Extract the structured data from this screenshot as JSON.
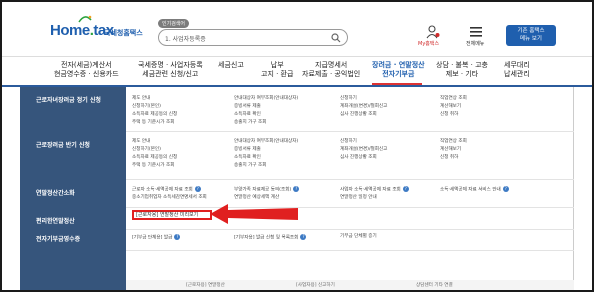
{
  "header": {
    "logo_text_a": "Home",
    "logo_text_b": "tax",
    "logo_sub": "국세청홈택스",
    "search_tag": "인기검색어",
    "search_value": "1. 사업자등록증",
    "my_label": "My홈택스",
    "menu_label": "전체메뉴",
    "basic_line1": "기존 홈택스",
    "basic_line2": "메뉴 보기"
  },
  "nav": [
    {
      "line1": "전자(세금)계산서",
      "line2": "현금영수증 · 신용카드"
    },
    {
      "line1": "국세증명 · 사업자등록",
      "line2": "세금관련 신청/신고"
    },
    {
      "line1": "세금신고",
      "line2": ""
    },
    {
      "line1": "납부",
      "line2": "고지 · 환급"
    },
    {
      "line1": "지급명세서",
      "line2": "자료제출 · 공익법인"
    },
    {
      "line1": "장려금 · 연말정산",
      "line2": "전자기부금"
    },
    {
      "line1": "상담 · 불복 · 고충",
      "line2": "제보 · 기타"
    },
    {
      "line1": "세무대리",
      "line2": "납세관리"
    }
  ],
  "categories": [
    "근로자녀장려금 정기 신청",
    "근로장려금 반기 신청",
    "연말정산간소화",
    "편리한연말정산",
    "전자기부금영수증"
  ],
  "rows": {
    "r1": {
      "c1": [
        "제도 안내",
        "신청하기(본인)",
        "소득자료 제공동의 신청",
        "주택 등 기준시가 조회"
      ],
      "c2": [
        "안내대상자 여부조회(안내대상자)",
        "증빙서류 제출",
        "소득자료 확인",
        "송출지 가구 조회"
      ],
      "c3": [
        "신청하기",
        "계좌개설(변경)/철회신고",
        "심사 진행상황 조회"
      ],
      "c4": [
        "직업연상 조회",
        "계산해보기",
        "신청 취하"
      ]
    },
    "r2": {
      "c1": [
        "제도 안내",
        "신청하기(본인)",
        "소득자료 제공동의 신청",
        "주택 등 기준시가 조회"
      ],
      "c2": [
        "안내대상자 여부조회(안내대상자)",
        "증빙서류 제출",
        "소득자료 확인",
        "송출지 가구 조회"
      ],
      "c3": [
        "신청하기",
        "계좌개설(변경)/철회신고",
        "심사 진행상황 조회"
      ],
      "c4": [
        "직업연상 조회",
        "계산해보기",
        "신청 취하"
      ]
    },
    "r3": {
      "c1": [
        "근로자 소득·세액공제 자료 조회",
        "중소기업취업자 소득세감면명세서 조회"
      ],
      "c2": [
        "부양가족 자료제공 동의(조회)",
        "연말정산 예상세액 계산"
      ],
      "c3": [
        "사업자 소득·세액공제 자료 조회",
        "연말정산 일정 안내"
      ],
      "c4": [
        "소득·세액공제 자료 서비스 안내"
      ]
    },
    "r4_highlight": "[근로자용] 연말정산 미리보기",
    "r5": {
      "c1": "[기부금 단체용] 발급",
      "c2": "[기부자용] 발급 신청 및 목록조회",
      "c3": "기부금 단체별 증기"
    },
    "bottom": [
      "[근로자용] 연말정산",
      "[사업자용] 신고하기",
      "상담센터 기타 연결"
    ]
  }
}
